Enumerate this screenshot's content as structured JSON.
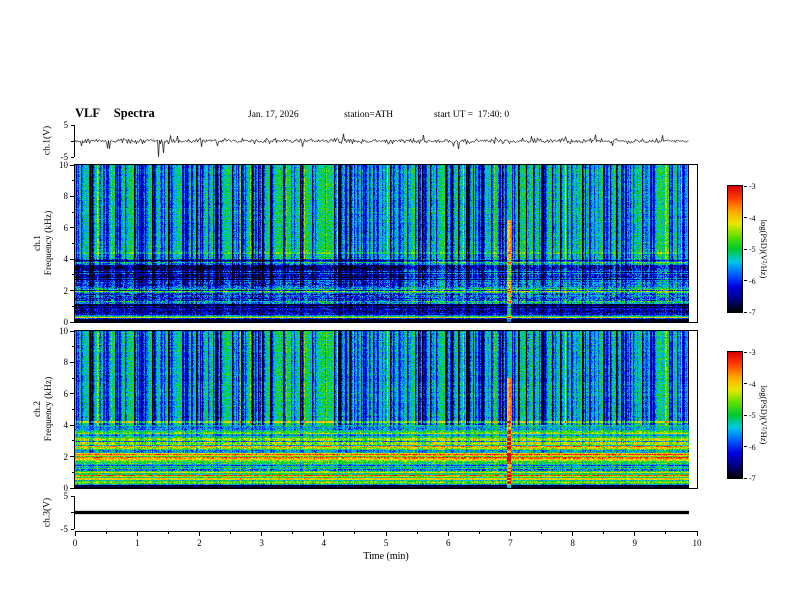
{
  "header": {
    "title": "VLF  Spectra",
    "date": "Jan. 17, 2026",
    "station": "station=ATH",
    "start_ut": "start UT =  17:40: 0"
  },
  "labels": {
    "ch1_wave": "ch.1(V)",
    "spec1_line1": "ch.1",
    "spec1_line2": "Frequency (kHz)",
    "spec2_line1": "ch.2",
    "spec2_line2": "Frequency (kHz)",
    "ch3_wave": "ch.3(V)",
    "xlabel": "Time (min)"
  },
  "xaxis": {
    "min": 0,
    "max": 10,
    "ticks": [
      0,
      1,
      2,
      3,
      4,
      5,
      6,
      7,
      8,
      9,
      10
    ],
    "minor_step": 0.5
  },
  "spec_yaxis": {
    "min": 0,
    "max": 10,
    "ticks": [
      10,
      8,
      6,
      4,
      2,
      0
    ]
  },
  "wave_yaxis": {
    "min": -5,
    "max": 5,
    "ticks": [
      {
        "v": 5,
        "label": "5"
      },
      {
        "v": 0,
        "label": ""
      },
      {
        "v": -5,
        "label": "-5"
      }
    ]
  },
  "colorbar": {
    "label": "log(PSD)(V²/Hz)",
    "max": -3,
    "min": -7,
    "ticks": [
      -3,
      -4,
      -5,
      -6,
      -7
    ],
    "stops": [
      {
        "v": -7.0,
        "c": "#000000"
      },
      {
        "v": -6.6,
        "c": "#000080"
      },
      {
        "v": -6.2,
        "c": "#0000e0"
      },
      {
        "v": -5.8,
        "c": "#0060ff"
      },
      {
        "v": -5.4,
        "c": "#00c8e8"
      },
      {
        "v": -5.0,
        "c": "#00c830"
      },
      {
        "v": -4.6,
        "c": "#60e000"
      },
      {
        "v": -4.2,
        "c": "#e8e800"
      },
      {
        "v": -3.8,
        "c": "#ffa800"
      },
      {
        "v": -3.4,
        "c": "#ff4000"
      },
      {
        "v": -3.0,
        "c": "#d80000"
      }
    ]
  },
  "shared": {
    "col_seed": 777
  },
  "chart_data": [
    {
      "type": "line",
      "name": "ch.1 waveform",
      "ylabel": "ch.1(V)",
      "xlabel": "Time (min)",
      "xlim": [
        0,
        10
      ],
      "ylim": [
        -5,
        5
      ],
      "x_end": 9.8,
      "summary": "Broadband noise of about ±1 V around 0 V with impulsive spikes of ±2–3 V; the largest negative spikes reach −5 V near t≈1.35 min.",
      "gen": {
        "seed": 42,
        "sigma": 0.38,
        "spike_prob": 0.05,
        "spike_amp": 1.9,
        "spikes": [
          {
            "t": 0.55,
            "v": -2.5
          },
          {
            "t": 1.33,
            "v": -5
          },
          {
            "t": 1.4,
            "v": -3.8
          },
          {
            "t": 4.28,
            "v": 2.3
          },
          {
            "t": 6.12,
            "v": -2.6
          },
          {
            "t": 8.3,
            "v": 2.0
          }
        ]
      }
    },
    {
      "type": "heatmap",
      "name": "ch.1 spectrogram",
      "ylabel": "Frequency (kHz)",
      "zlabel": "log(PSD)(V²/Hz)",
      "xlim": [
        0,
        10
      ],
      "ylim": [
        0,
        10
      ],
      "zlim": [
        -7,
        -3
      ],
      "x_end": 9.8,
      "seed": 1001,
      "summary": "Green background (≈10^-5 V²/Hz) above 4 kHz crossed by dense dark-blue vertical sferic striations; blue/cyan banded structure 1–4 kHz; dark band 0.5–1.2 kHz; black below 0.25 kHz with a green line near 0.35 kHz; the 1–4 kHz structure brightens after ≈5.3 min; narrow enhancement column near t≈6.9 min.",
      "bands": [
        {
          "f0": 0,
          "f1": 0.22,
          "base": -6.9,
          "noise": 0.2,
          "stripe": 0.3,
          "streak": 0
        },
        {
          "f0": 0.22,
          "f1": 0.45,
          "base": -5.3,
          "noise": 0.4,
          "stripe": 0.9,
          "streak": 0.2
        },
        {
          "f0": 0.45,
          "f1": 1.15,
          "base": -6.4,
          "noise": 0.5,
          "stripe": 0.4,
          "streak": 0.2
        },
        {
          "f0": 1.15,
          "f1": 2.3,
          "base": -5.6,
          "noise": 0.6,
          "stripe": 0.7,
          "streak": 0.4
        },
        {
          "f0": 2.3,
          "f1": 4.0,
          "base": -6.0,
          "noise": 0.5,
          "stripe": 0.6,
          "streak": 0.6
        },
        {
          "f0": 4.0,
          "f1": 10.01,
          "base": -5.0,
          "noise": 0.35,
          "stripe": 0.15,
          "streak": 1.0
        }
      ],
      "h_lines": [
        {
          "f": 0.33,
          "boost": 1.0
        },
        {
          "f": 1.3,
          "boost": 0.7
        },
        {
          "f": 1.9,
          "boost": 0.8
        },
        {
          "f": 2.5,
          "boost": 0.8
        },
        {
          "f": 3.1,
          "boost": 0.7
        },
        {
          "f": 3.75,
          "boost": 0.6
        },
        {
          "f": 4.4,
          "boost": 0.4
        }
      ],
      "phase2": {
        "t": 5.25,
        "adjust": [
          {
            "f0": 1.15,
            "f1": 2.3,
            "delta": 0.3
          },
          {
            "f0": 2.3,
            "f1": 4.0,
            "delta": 0.45
          },
          {
            "f0": 4.0,
            "f1": 10.01,
            "delta": 0.1
          }
        ]
      },
      "event": {
        "t": 6.93,
        "w": 0.03,
        "f_max": 6.5,
        "boost": 1.2
      }
    },
    {
      "type": "heatmap",
      "name": "ch.2 spectrogram",
      "ylabel": "Frequency (kHz)",
      "zlabel": "log(PSD)(V²/Hz)",
      "xlim": [
        0,
        10
      ],
      "ylim": [
        0,
        10
      ],
      "zlim": [
        -7,
        -3
      ],
      "x_end": 9.8,
      "seed": 2002,
      "summary": "Same sferic-striated green background above 4 kHz; strong banded emission below 4 kHz: yellow-green stripes 2.3–4 kHz, intense orange-red band 1.7–2.25 kHz, bright green-yellow band 0.25–1.1 kHz with red power-line harmonic lines; black below 0.25 kHz; enhancement column near t≈6.9 min.",
      "bands": [
        {
          "f0": 0,
          "f1": 0.22,
          "base": -6.9,
          "noise": 0.2,
          "stripe": 0.3,
          "streak": 0
        },
        {
          "f0": 0.22,
          "f1": 1.1,
          "base": -4.7,
          "noise": 0.4,
          "stripe": 0.9,
          "streak": 0.15
        },
        {
          "f0": 1.1,
          "f1": 1.7,
          "base": -5.2,
          "noise": 0.45,
          "stripe": 0.7,
          "streak": 0.2
        },
        {
          "f0": 1.7,
          "f1": 2.25,
          "base": -4.3,
          "noise": 0.4,
          "stripe": 0.8,
          "streak": 0.15
        },
        {
          "f0": 2.25,
          "f1": 4.0,
          "base": -4.9,
          "noise": 0.45,
          "stripe": 0.8,
          "streak": 0.3
        },
        {
          "f0": 4.0,
          "f1": 10.01,
          "base": -5.0,
          "noise": 0.35,
          "stripe": 0.15,
          "streak": 1.0
        }
      ],
      "h_lines": [
        {
          "f": 0.35,
          "boost": 1.0
        },
        {
          "f": 0.55,
          "boost": 1.4
        },
        {
          "f": 0.8,
          "boost": 1.1
        },
        {
          "f": 1.95,
          "boost": 1.2
        },
        {
          "f": 2.1,
          "boost": 0.9
        },
        {
          "f": 2.6,
          "boost": 0.8
        },
        {
          "f": 3.05,
          "boost": 0.9
        },
        {
          "f": 3.5,
          "boost": 0.7
        },
        {
          "f": 4.2,
          "boost": 0.9
        }
      ],
      "phase2": {
        "t": 5.25,
        "adjust": [
          {
            "f0": 2.25,
            "f1": 4.0,
            "delta": 0.2
          },
          {
            "f0": 1.7,
            "f1": 2.25,
            "delta": 0.15
          }
        ]
      },
      "event": {
        "t": 6.93,
        "w": 0.03,
        "f_max": 7.0,
        "boost": 1.5
      }
    },
    {
      "type": "line",
      "name": "ch.3 waveform",
      "ylabel": "ch.3(V)",
      "xlabel": "Time (min)",
      "xlim": [
        0,
        10
      ],
      "ylim": [
        -5,
        5
      ],
      "x_end": 9.8,
      "summary": "Constant ≈0 V — flat heavy black line across the full record (no signal on channel 3).",
      "gen": {
        "constant": 0,
        "thickness_v": 0.5
      }
    }
  ]
}
